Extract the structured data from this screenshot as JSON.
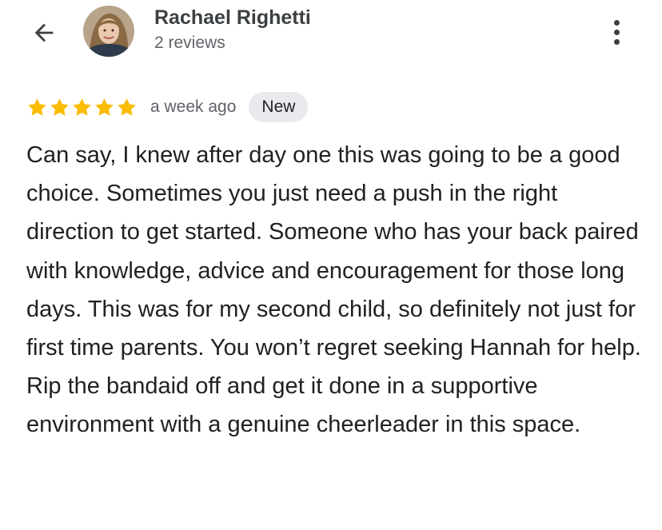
{
  "header": {
    "reviewer_name": "Rachael Righetti",
    "review_count": "2 reviews",
    "back_icon": "arrow-left-icon",
    "more_icon": "more-vertical-icon"
  },
  "review": {
    "rating": 5,
    "rating_max": 5,
    "time": "a week ago",
    "badge": "New",
    "text": "Can say, I knew after day one this was going to be a good choice. Sometimes you just need a push in the right direction to get started. Someone who has your back paired with knowledge, advice and encouragement for those long days. This was for my second child, so definitely not just for first time parents. You won’t regret seeking Hannah for help. Rip the bandaid off and get it done in a supportive environment with a genuine cheerleader in this space."
  },
  "colors": {
    "star": "#fbbc04",
    "badge_bg": "#e8eaed",
    "text": "#202124",
    "secondary_text": "#5f6368"
  }
}
